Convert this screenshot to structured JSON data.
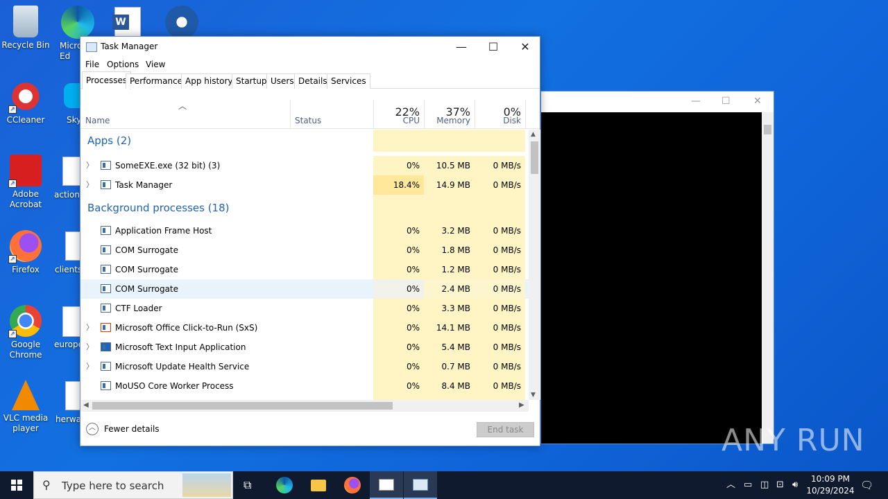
{
  "desktop": {
    "icons": [
      {
        "label": "Recycle Bin"
      },
      {
        "label": "CCleaner"
      },
      {
        "label": "Adobe Acrobat"
      },
      {
        "label": "Firefox"
      },
      {
        "label": "Google Chrome"
      },
      {
        "label": "VLC media player"
      }
    ],
    "partial_icons": [
      {
        "label": "Micro Ed"
      },
      {
        "label": "Sky"
      },
      {
        "label": "action"
      },
      {
        "label": "clients"
      },
      {
        "label": "europe"
      },
      {
        "label": "herway"
      }
    ]
  },
  "task_manager": {
    "title": "Task Manager",
    "menu": [
      "File",
      "Options",
      "View"
    ],
    "tabs": [
      "Processes",
      "Performance",
      "App history",
      "Startup",
      "Users",
      "Details",
      "Services"
    ],
    "active_tab": "Processes",
    "columns": {
      "name": "Name",
      "status": "Status",
      "cpu": {
        "label": "CPU",
        "total": "22%"
      },
      "memory": {
        "label": "Memory",
        "total": "37%"
      },
      "disk": {
        "label": "Disk",
        "total": "0%"
      }
    },
    "groups": [
      {
        "title": "Apps (2)"
      },
      {
        "title": "Background processes (18)"
      }
    ],
    "rows": [
      {
        "name": "SomeEXE.exe (32 bit) (3)",
        "cpu": "0%",
        "memory": "10.5 MB",
        "disk": "0 MB/s",
        "expandable": true
      },
      {
        "name": "Task Manager",
        "cpu": "18.4%",
        "memory": "14.9 MB",
        "disk": "0 MB/s",
        "expandable": true
      },
      {
        "name": "Application Frame Host",
        "cpu": "0%",
        "memory": "3.2 MB",
        "disk": "0 MB/s"
      },
      {
        "name": "COM Surrogate",
        "cpu": "0%",
        "memory": "1.8 MB",
        "disk": "0 MB/s"
      },
      {
        "name": "COM Surrogate",
        "cpu": "0%",
        "memory": "1.2 MB",
        "disk": "0 MB/s"
      },
      {
        "name": "COM Surrogate",
        "cpu": "0%",
        "memory": "2.4 MB",
        "disk": "0 MB/s",
        "selected": true
      },
      {
        "name": "CTF Loader",
        "cpu": "0%",
        "memory": "3.3 MB",
        "disk": "0 MB/s"
      },
      {
        "name": "Microsoft Office Click-to-Run (SxS)",
        "cpu": "0%",
        "memory": "14.1 MB",
        "disk": "0 MB/s",
        "expandable": true
      },
      {
        "name": "Microsoft Text Input Application",
        "cpu": "0%",
        "memory": "5.4 MB",
        "disk": "0 MB/s",
        "expandable": true
      },
      {
        "name": "Microsoft Update Health Service",
        "cpu": "0%",
        "memory": "0.7 MB",
        "disk": "0 MB/s",
        "expandable": true
      },
      {
        "name": "MoUSO Core Worker Process",
        "cpu": "0%",
        "memory": "8.4 MB",
        "disk": "0 MB/s"
      }
    ],
    "footer": {
      "fewer_details": "Fewer details",
      "end_task": "End task"
    }
  },
  "taskbar": {
    "search_placeholder": "Type here to search",
    "time": "10:09 PM",
    "date": "10/29/2024"
  },
  "watermark": "ANY RUN",
  "colors": {
    "accent": "#1e63b4",
    "highlight": "#fff4c4",
    "cpu_high": "#ffe89a"
  }
}
